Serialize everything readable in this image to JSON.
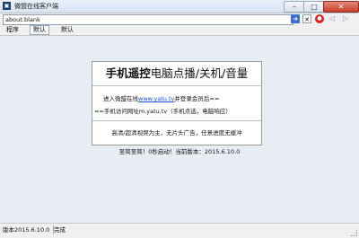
{
  "window": {
    "title": "微盟在线客户端"
  },
  "address_bar": {
    "url": "about:blank"
  },
  "menu": [
    {
      "label": "程序"
    },
    {
      "label": "默认"
    },
    {
      "label": "默认"
    }
  ],
  "card": {
    "title_bold": "手机遥控",
    "title_rest": "电脑点播/关机/音量",
    "line1_prefix": "进入微盟在线",
    "line1_link": "www.yatu.tv",
    "line1_suffix": "并登录会员后==",
    "line2": "==手机访问网址m.yatu.tv（手机点选，电脑响应）",
    "footer": "高清/超清视频为主，无片头广告，任意进度无缓冲"
  },
  "slogan": "至简至简！0秒启动！当前版本：2015.6.10.0",
  "status": {
    "version": "版本2015.6.10.0",
    "state": "完成"
  }
}
